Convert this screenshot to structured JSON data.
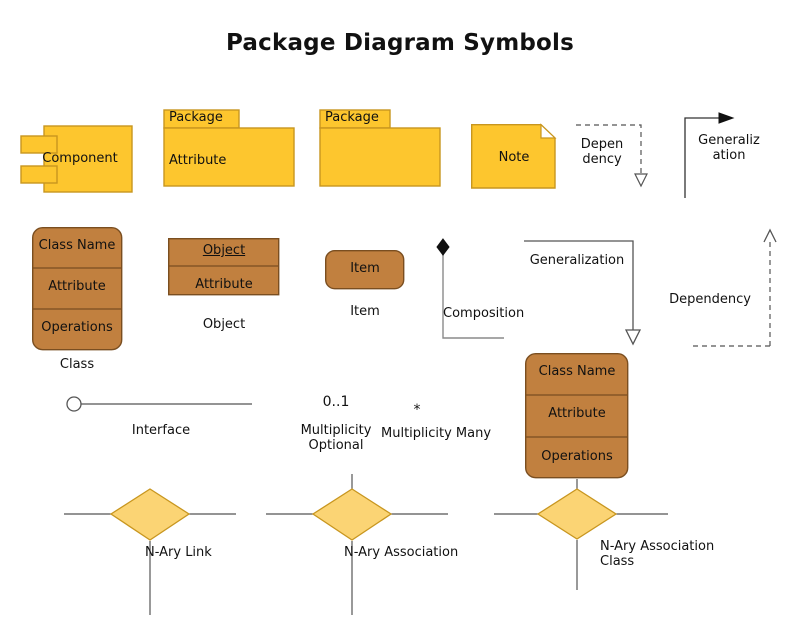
{
  "title": "Package Diagram Symbols",
  "colors": {
    "package_fill": "#FDC62E",
    "package_stroke": "#C8961F",
    "class_fill": "#C1803F",
    "class_stroke": "#7A4E20",
    "diamond_fill": "#FBD474",
    "diamond_stroke": "#C8961F",
    "line": "#555555",
    "text": "#111111",
    "note_fold": "#ffffff"
  },
  "symbols": {
    "component": {
      "label": "Component",
      "caption": ""
    },
    "package_attribute": {
      "tab_label": "Package",
      "body_label": "Attribute"
    },
    "package_empty": {
      "tab_label": "Package",
      "body_label": ""
    },
    "note": {
      "label": "Note"
    },
    "class": {
      "name": "Class Name",
      "attribute": "Attribute",
      "operations": "Operations",
      "caption": "Class"
    },
    "object": {
      "name": "Object",
      "attribute": "Attribute",
      "caption": "Object"
    },
    "item": {
      "label": "Item",
      "caption": "Item"
    },
    "association_class": {
      "name": "Class Name",
      "attribute": "Attribute",
      "operations": "Operations"
    },
    "interface": {
      "caption": "Interface"
    },
    "multiplicity_optional": {
      "value": "0..1",
      "caption": "Multiplicity\nOptional"
    },
    "multiplicity_many": {
      "value": "*",
      "caption": "Multiplicity Many"
    },
    "nary_link": {
      "caption": "N-Ary Link"
    },
    "nary_association": {
      "caption": "N-Ary Association"
    },
    "nary_association_class": {
      "caption": "N-Ary Association\nClass"
    }
  },
  "relationships": {
    "dependency_top": {
      "label": "Depen\ndency",
      "style": "dashed",
      "arrowhead": "hollow-triangle"
    },
    "generalization_top": {
      "label": "Generaliz\nation",
      "style": "solid",
      "arrowhead": "filled-arrow"
    },
    "composition": {
      "label": "Composition",
      "style": "solid",
      "arrowhead": "filled-diamond"
    },
    "generalization_mid": {
      "label": "Generalization",
      "style": "solid",
      "arrowhead": "hollow-triangle"
    },
    "dependency_right": {
      "label": "Dependency",
      "style": "dashed",
      "arrowhead": "open-arrow"
    }
  }
}
